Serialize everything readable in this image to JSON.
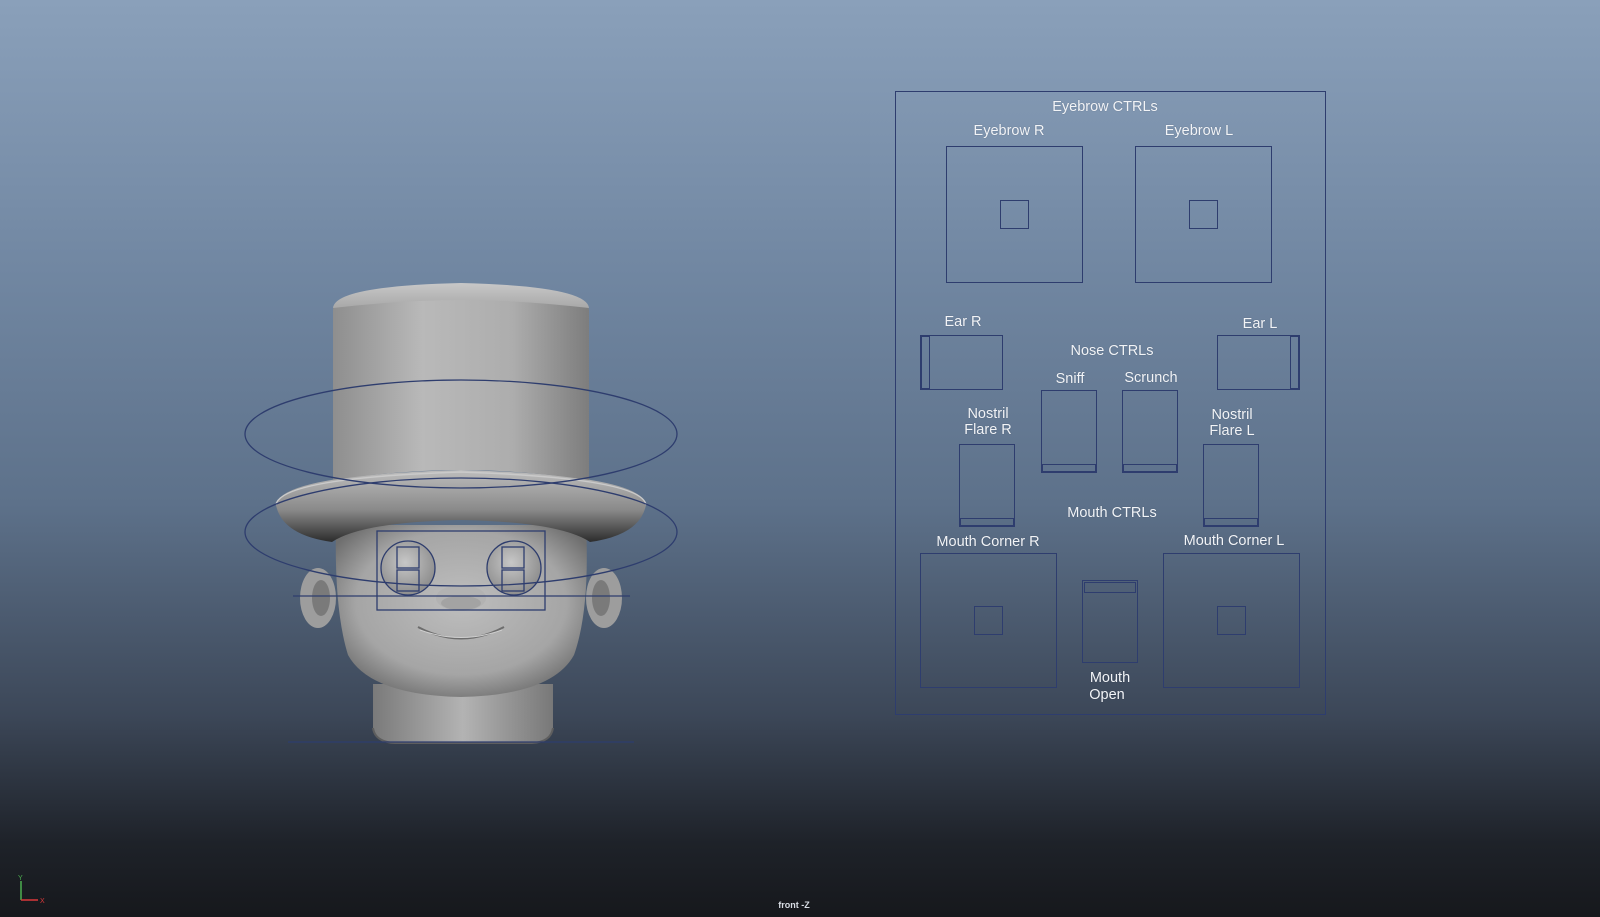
{
  "colors": {
    "control_line": "#2e3d6e",
    "label_text": "#f2f4f7",
    "mesh_light": "#b5b5b5",
    "mesh_dark": "#5a5a5a"
  },
  "viewport": {
    "camera": "front -Z",
    "axis_y": "Y",
    "axis_x": "X"
  },
  "panel": {
    "eyebrow_title": "Eyebrow CTRLs",
    "eyebrow_r": "Eyebrow R",
    "eyebrow_l": "Eyebrow L",
    "ear_r": "Ear R",
    "ear_l": "Ear L",
    "nose_title": "Nose CTRLs",
    "sniff": "Sniff",
    "scrunch": "Scrunch",
    "nostril_r_1": "Nostril",
    "nostril_r_2": "Flare R",
    "nostril_l_1": "Nostril",
    "nostril_l_2": "Flare L",
    "mouth_title": "Mouth CTRLs",
    "mouth_corner_r": "Mouth Corner R",
    "mouth_corner_l": "Mouth Corner L",
    "mouth_open_1": "Mouth",
    "mouth_open_2": "Open"
  }
}
